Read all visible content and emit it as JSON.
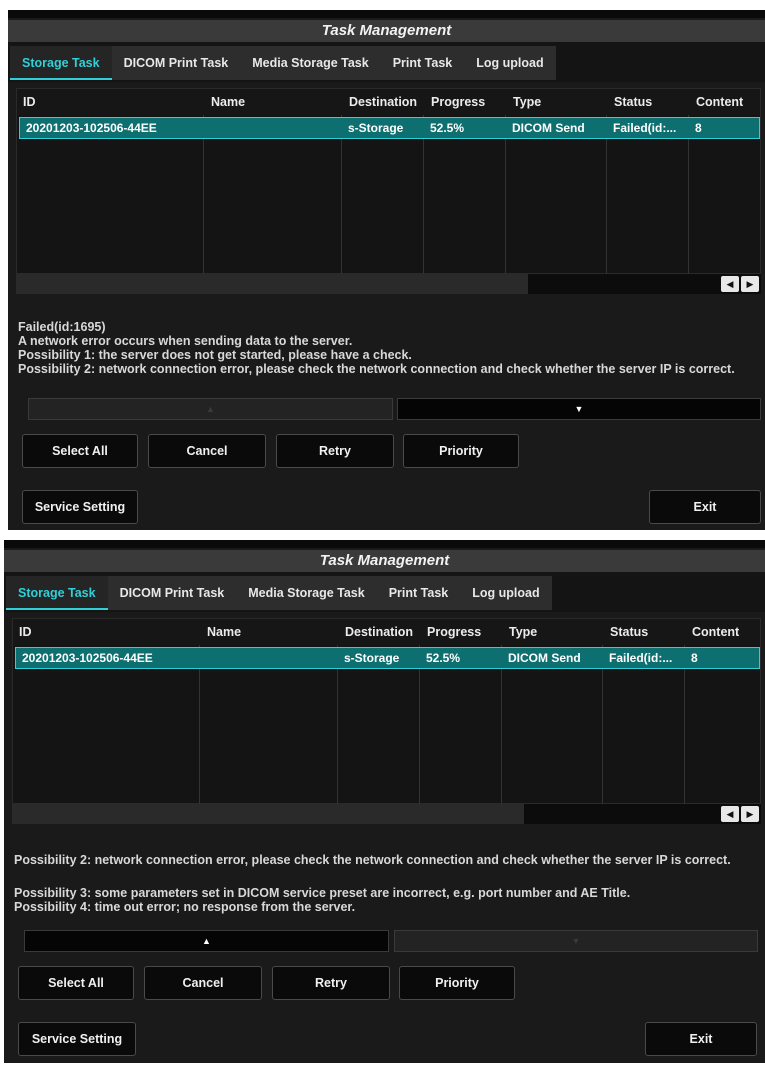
{
  "dialog": {
    "title": "Task Management",
    "tabs": [
      "Storage Task",
      "DICOM Print Task",
      "Media Storage Task",
      "Print Task",
      "Log upload"
    ],
    "active_tab": "Storage Task"
  },
  "table": {
    "columns": [
      "ID",
      "Name",
      "Destination",
      "Progress",
      "Type",
      "Status",
      "Content"
    ],
    "rows": [
      {
        "id": "20201203-102506-44EE",
        "name": "",
        "destination": "s-Storage",
        "progress": "52.5%",
        "type": "DICOM Send",
        "status": "Failed(id:...",
        "content": "8"
      }
    ]
  },
  "scroll": {
    "left_icon": "arrow-left-icon",
    "right_icon": "arrow-right-icon"
  },
  "messages_top": [
    "Failed(id:1695)",
    "A network error occurs when sending data to the server.",
    "Possibility 1: the server does not get started, please have a check.",
    "Possibility 2: network connection error, please check the network connection and check whether the server IP is correct."
  ],
  "messages_bottom": [
    "Possibility 2: network connection error, please check the network connection and check whether the server IP is correct.",
    "Possibility 3: some parameters set in DICOM service preset are incorrect, e.g. port number and AE Title.",
    "Possibility 4: time out error; no response from the server."
  ],
  "pager": {
    "up": "▲",
    "down": "▼"
  },
  "buttons": {
    "select_all": "Select All",
    "cancel": "Cancel",
    "retry": "Retry",
    "priority": "Priority",
    "service_setting": "Service Setting",
    "exit": "Exit"
  },
  "colors": {
    "accent": "#2fd0d8",
    "selected_row": "#0e6f71",
    "background": "#1a1a1a"
  }
}
